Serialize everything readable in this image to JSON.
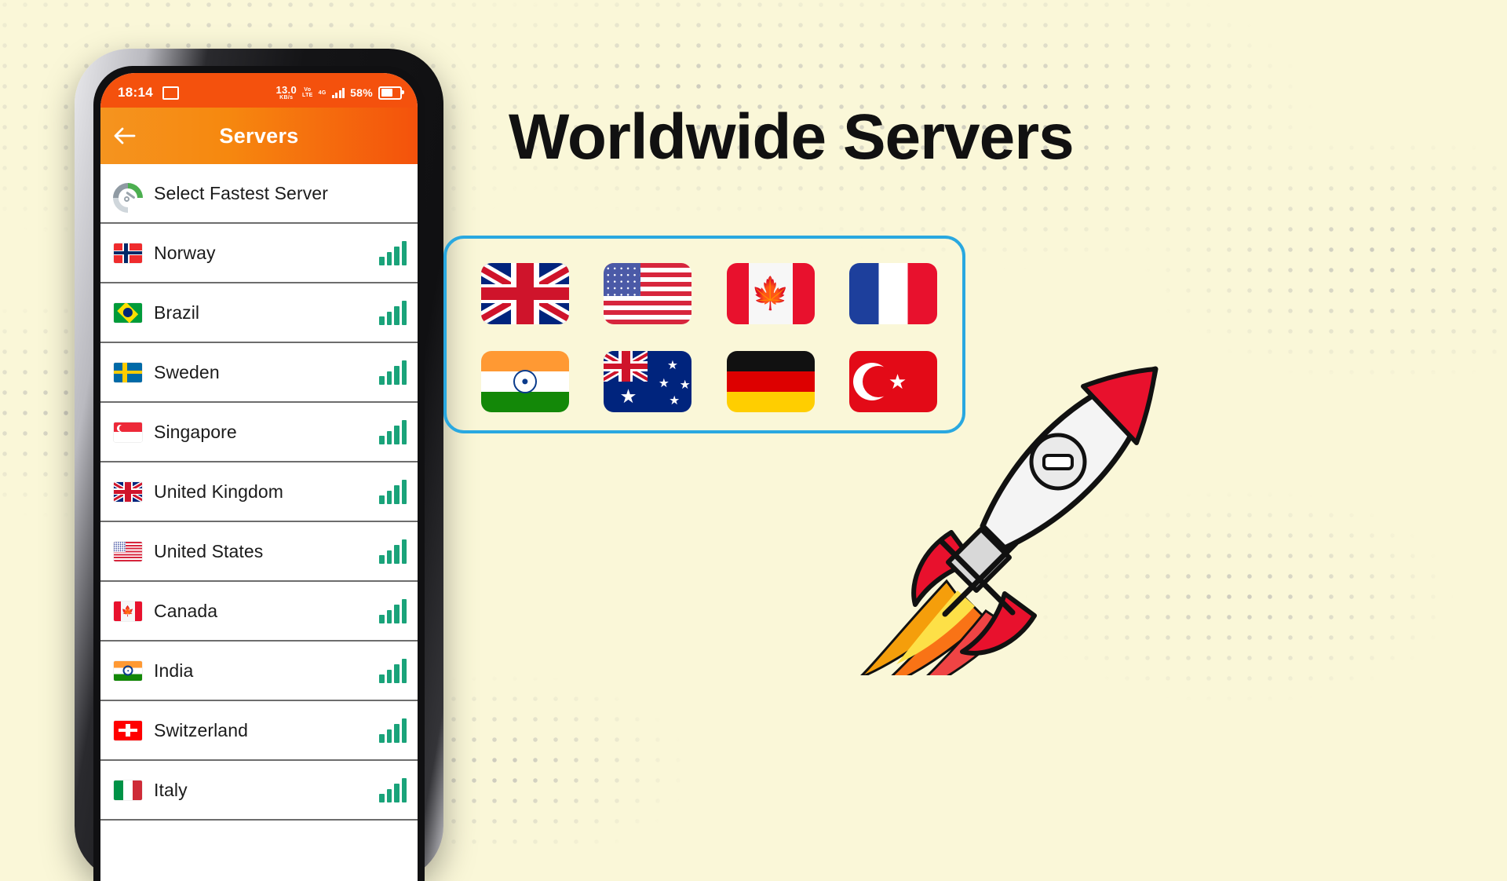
{
  "banner": {
    "headline": "Worldwide Servers",
    "background_color": "#faf7d8",
    "accent_color": "#29a8e0",
    "rocket_body_color": "#f2f2f2",
    "rocket_accent_color": "#e8112d"
  },
  "phone": {
    "status_bar": {
      "time": "18:14",
      "cast_icon": "cast-icon",
      "net_speed_value": "13.0",
      "net_speed_unit": "KB/s",
      "vo_label_top": "Vo",
      "vo_label_bottom": "LTE",
      "signal_label": "4G",
      "battery_percent": "58%"
    },
    "app_bar": {
      "back_icon": "back-arrow-icon",
      "title": "Servers",
      "gradient_from": "#f5941f",
      "gradient_to": "#f4520c"
    },
    "server_list": [
      {
        "label": "Select Fastest Server",
        "icon": "speedometer-icon",
        "flag": "none",
        "signal": 0
      },
      {
        "label": "Norway",
        "icon": "flag-icon",
        "flag": "no",
        "signal": 4
      },
      {
        "label": "Brazil",
        "icon": "flag-icon",
        "flag": "br",
        "signal": 4
      },
      {
        "label": "Sweden",
        "icon": "flag-icon",
        "flag": "se",
        "signal": 4
      },
      {
        "label": "Singapore",
        "icon": "flag-icon",
        "flag": "sg",
        "signal": 4
      },
      {
        "label": "United Kingdom",
        "icon": "flag-icon",
        "flag": "uk",
        "signal": 4
      },
      {
        "label": "United States",
        "icon": "flag-icon",
        "flag": "us",
        "signal": 4
      },
      {
        "label": "Canada",
        "icon": "flag-icon",
        "flag": "ca",
        "signal": 4
      },
      {
        "label": "India",
        "icon": "flag-icon",
        "flag": "in",
        "signal": 4
      },
      {
        "label": "Switzerland",
        "icon": "flag-icon",
        "flag": "ch",
        "signal": 4
      },
      {
        "label": "Italy",
        "icon": "flag-icon",
        "flag": "it",
        "signal": 4
      }
    ]
  },
  "flag_panel": {
    "border_color": "#29a8e0",
    "flags": [
      {
        "code": "uk",
        "name": "United Kingdom"
      },
      {
        "code": "us",
        "name": "United States"
      },
      {
        "code": "ca",
        "name": "Canada"
      },
      {
        "code": "fr",
        "name": "France"
      },
      {
        "code": "in",
        "name": "India"
      },
      {
        "code": "au",
        "name": "Australia"
      },
      {
        "code": "de",
        "name": "Germany"
      },
      {
        "code": "tr",
        "name": "Turkey"
      }
    ]
  }
}
